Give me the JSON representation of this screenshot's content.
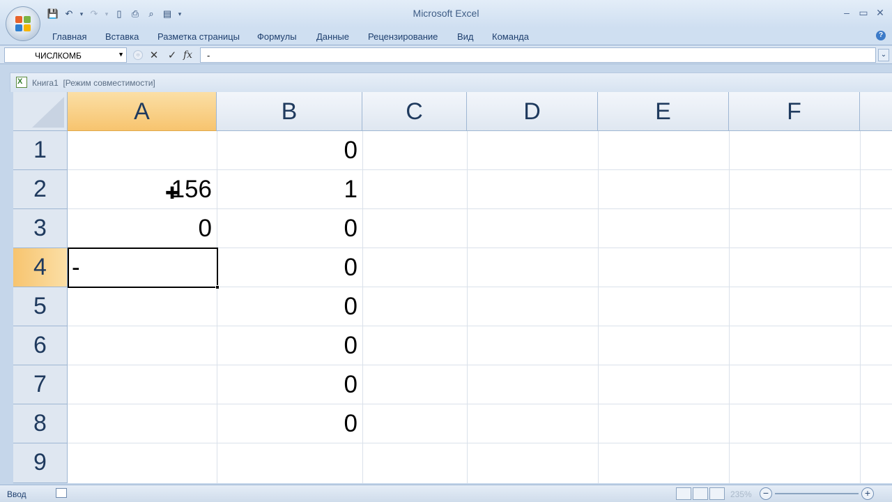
{
  "window": {
    "title": "Microsoft Excel"
  },
  "ribbon": {
    "tabs": [
      "Главная",
      "Вставка",
      "Разметка страницы",
      "Формулы",
      "Данные",
      "Рецензирование",
      "Вид",
      "Команда"
    ]
  },
  "formula_bar": {
    "name_box": "ЧИСЛКОМБ",
    "cancel_symbol": "✕",
    "enter_symbol": "✓",
    "fx_label": "fx",
    "content": "-"
  },
  "workbook": {
    "name": "Книга1",
    "mode": "[Режим совместимости]"
  },
  "sheet": {
    "columns": [
      "A",
      "B",
      "C",
      "D",
      "E",
      "F"
    ],
    "rows": [
      "1",
      "2",
      "3",
      "4",
      "5",
      "6",
      "7",
      "8",
      "9"
    ],
    "active_cell": "A4",
    "cells": {
      "A2": "156",
      "A3": "0",
      "A4": "-",
      "B1": "0",
      "B2": "1",
      "B3": "0",
      "B4": "0",
      "B5": "0",
      "B6": "0",
      "B7": "0",
      "B8": "0"
    }
  },
  "status_bar": {
    "mode": "Ввод",
    "zoom": "235%"
  },
  "colors": {
    "active_header": "#f7c46f",
    "header_bg": "#dfe7f1",
    "chrome": "#cfdff1"
  }
}
